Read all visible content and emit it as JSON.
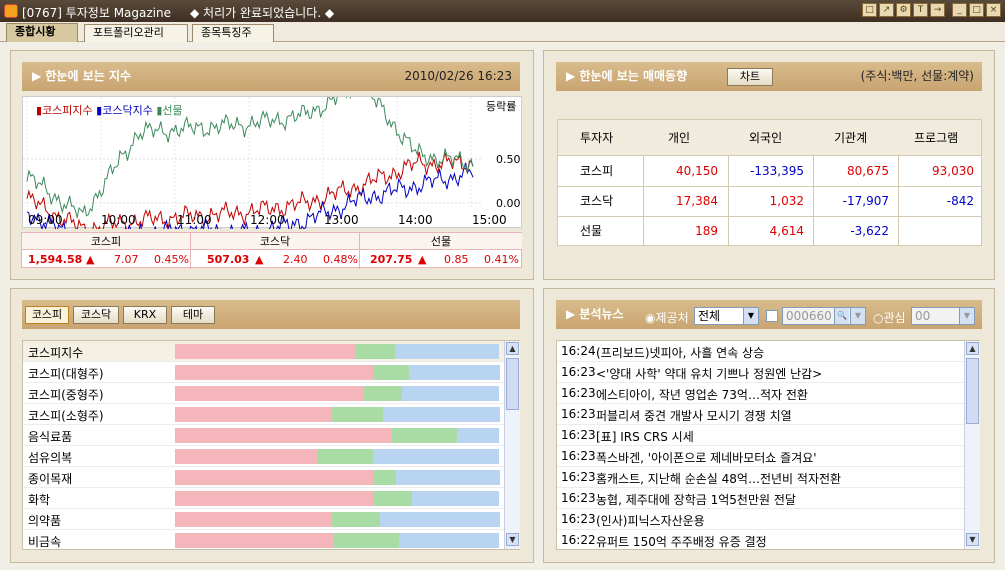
{
  "window": {
    "title": "[0767] 투자정보 Magazine",
    "message": "◆ 처리가 완료되었습니다. ◆"
  },
  "tabs": [
    {
      "label": "종합시황"
    },
    {
      "label": "포트폴리오관리"
    },
    {
      "label": "종목특징주"
    }
  ],
  "index_panel": {
    "title": "▶ 한눈에 보는 지수",
    "datetime": "2010/02/26 16:23",
    "legend": [
      "코스피지수",
      "코스닥지수",
      "선물"
    ],
    "legend_colors": [
      "#c00000",
      "#0000c0",
      "#3c8a5a"
    ],
    "ylabel": "등락률",
    "yticks": [
      "0.50",
      "0.00"
    ],
    "xticks": [
      "09:00",
      "10:00",
      "11:00",
      "12:00",
      "13:00",
      "14:00",
      "15:00"
    ],
    "summary": [
      {
        "name": "코스피",
        "value": "1,594.58",
        "arrow": "▲",
        "change": "7.07",
        "pct": "0.45%"
      },
      {
        "name": "코스닥",
        "value": "507.03",
        "arrow": "▲",
        "change": "2.40",
        "pct": "0.48%"
      },
      {
        "name": "선물",
        "value": "207.75",
        "arrow": "▲",
        "change": "0.85",
        "pct": "0.41%"
      }
    ]
  },
  "chart_data": {
    "type": "line",
    "x": [
      "09:00",
      "10:00",
      "11:00",
      "12:00",
      "13:00",
      "14:00",
      "15:00"
    ],
    "ylabel": "등락률",
    "yticks": [
      0.0,
      0.5
    ],
    "series": [
      {
        "name": "코스피지수",
        "color": "#c00000",
        "values": [
          0.05,
          -0.3,
          -0.2,
          -0.15,
          -0.1,
          0.0,
          0.2,
          0.45,
          0.45
        ]
      },
      {
        "name": "코스닥지수",
        "color": "#0000c0",
        "values": [
          -0.1,
          -0.45,
          -0.35,
          -0.3,
          -0.35,
          -0.2,
          0.05,
          0.2,
          0.35
        ]
      },
      {
        "name": "선물",
        "color": "#3c8a5a",
        "values": [
          0.3,
          -0.15,
          0.8,
          0.85,
          0.9,
          1.0,
          1.35,
          0.55,
          0.45
        ]
      }
    ]
  },
  "trade_panel": {
    "title": "▶ 한눈에 보는 매매동향",
    "chart_button": "차트",
    "unit": "(주식:백만, 선물:계약)",
    "headers": [
      "투자자",
      "개인",
      "외국인",
      "기관계",
      "프로그램"
    ],
    "rows": [
      {
        "name": "코스피",
        "vals": [
          "40,150",
          "-133,395",
          "80,675",
          "93,030"
        ],
        "colors": [
          "#d00",
          "#0000c8",
          "#d00",
          "#d00"
        ]
      },
      {
        "name": "코스닥",
        "vals": [
          "17,384",
          "1,032",
          "-17,907",
          "-842"
        ],
        "colors": [
          "#d00",
          "#d00",
          "#0000c8",
          "#0000c8"
        ]
      },
      {
        "name": "선물",
        "vals": [
          "189",
          "4,614",
          "-3,622",
          ""
        ],
        "colors": [
          "#d00",
          "#d00",
          "#0000c8",
          "#d00"
        ]
      }
    ]
  },
  "sector_panel": {
    "buttons": [
      "코스피",
      "코스닥",
      "KRX",
      "테마"
    ],
    "rows": [
      {
        "name": "코스피지수",
        "s": [
          0.56,
          0.12,
          0.32
        ]
      },
      {
        "name": "코스피(대형주)",
        "s": [
          0.61,
          0.11,
          0.28
        ]
      },
      {
        "name": "코스피(중형주)",
        "s": [
          0.58,
          0.12,
          0.3
        ]
      },
      {
        "name": "코스피(소형주)",
        "s": [
          0.48,
          0.16,
          0.36
        ]
      },
      {
        "name": "음식료품",
        "s": [
          0.67,
          0.2,
          0.13
        ]
      },
      {
        "name": "섬유의복",
        "s": [
          0.44,
          0.17,
          0.39
        ]
      },
      {
        "name": "종이목재",
        "s": [
          0.61,
          0.07,
          0.32
        ]
      },
      {
        "name": "화학",
        "s": [
          0.61,
          0.12,
          0.27
        ]
      },
      {
        "name": "의약품",
        "s": [
          0.48,
          0.15,
          0.37
        ]
      },
      {
        "name": "비금속",
        "s": [
          0.49,
          0.2,
          0.31
        ]
      }
    ],
    "colors": {
      "up": "#f4b6bb",
      "flat": "#a8dca4",
      "down": "#b8d4f0"
    }
  },
  "news_panel": {
    "title": "▶ 분석뉴스",
    "radio_provider": "제공처",
    "provider": "전체",
    "code": "000660",
    "radio_interest": "관심",
    "interest": "00",
    "items": [
      {
        "time": "16:24",
        "headline": "(프리보드)넷피아, 사흘 연속 상승"
      },
      {
        "time": "16:23",
        "headline": "<'양대 사학' 약대 유치 기쁘나 정원엔 난감>"
      },
      {
        "time": "16:23",
        "headline": "에스티아이, 작년 영업손 73억…적자 전환"
      },
      {
        "time": "16:23",
        "headline": "퍼블리셔 중견 개발사 모시기 경쟁 치열"
      },
      {
        "time": "16:23",
        "headline": "[표] IRS CRS 시세"
      },
      {
        "time": "16:23",
        "headline": "폭스바겐, '아이폰으로 제네바모터쇼 즐겨요'"
      },
      {
        "time": "16:23",
        "headline": "홈캐스트, 지난해 순손실 48억…전년비 적자전환"
      },
      {
        "time": "16:23",
        "headline": "농협, 제주대에 장학금 1억5천만원 전달"
      },
      {
        "time": "16:23",
        "headline": "(인사)피닉스자산운용"
      },
      {
        "time": "16:22",
        "headline": "유퍼트 150억 주주배정 유증 결정"
      }
    ]
  }
}
